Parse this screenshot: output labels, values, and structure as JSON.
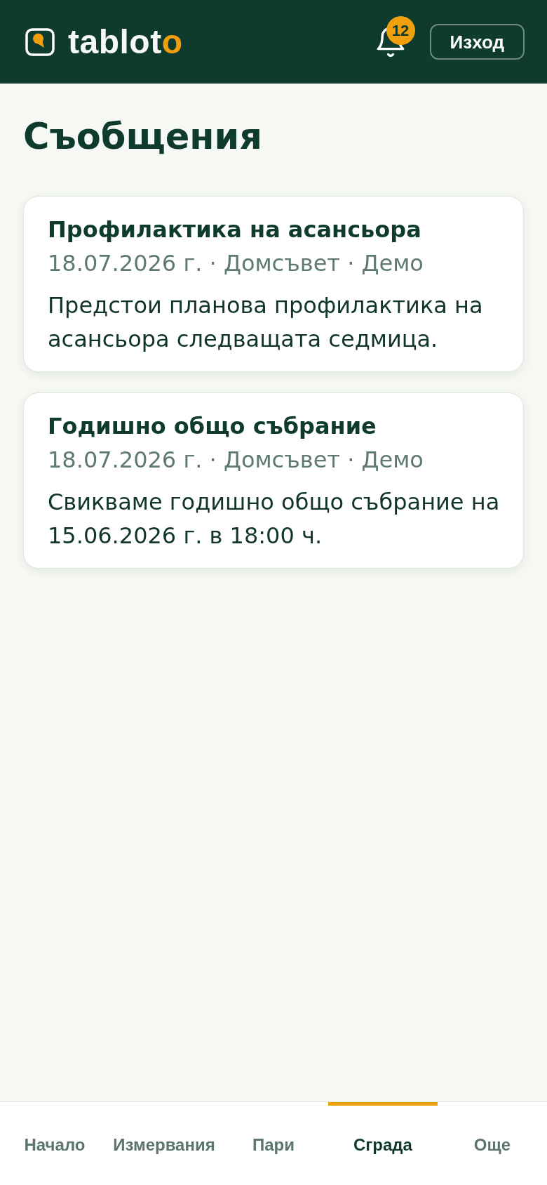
{
  "header": {
    "logo": {
      "text": "tablot",
      "accent_text": "o"
    },
    "notifications": {
      "count": "12"
    },
    "logout_button": "Изход"
  },
  "page": {
    "title": "Съобщения"
  },
  "messages": [
    {
      "title": "Профилактика на асансьора",
      "meta": "18.07.2026 г. · Домсъвет · Демо",
      "body": "Предстои планова профилактика на асансьора следващата седмица."
    },
    {
      "title": "Годишно общо събрание",
      "meta": "18.07.2026 г. · Домсъвет · Демо",
      "body": "Свикваме годишно общо събрание на 15.06.2026 г. в 18:00 ч."
    }
  ],
  "bottom_nav": [
    {
      "label": "Начало",
      "selected": false
    },
    {
      "label": "Измервания",
      "selected": false
    },
    {
      "label": "Пари",
      "selected": false
    },
    {
      "label": "Сграда",
      "selected": true
    },
    {
      "label": "Още",
      "selected": false
    }
  ]
}
